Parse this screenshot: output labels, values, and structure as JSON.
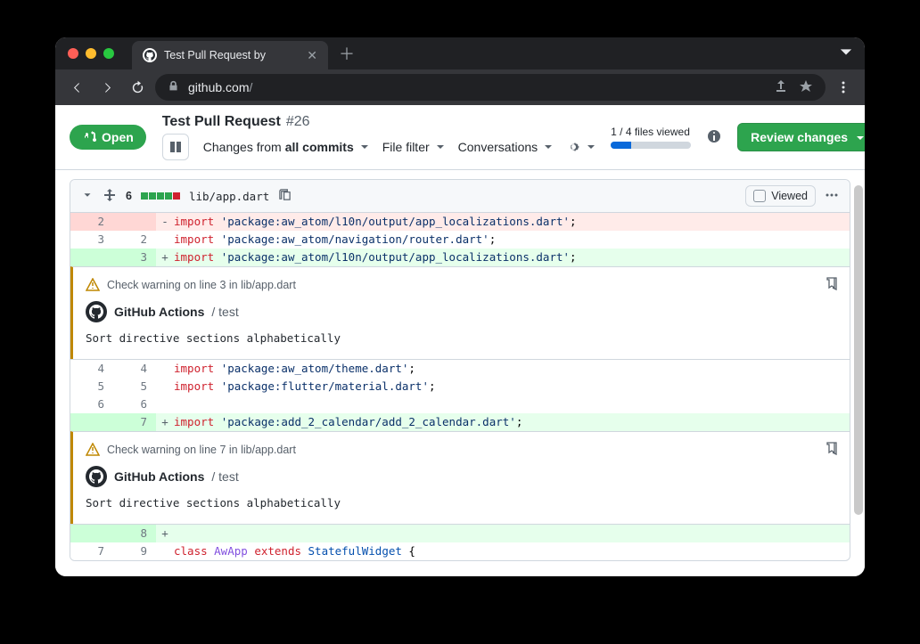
{
  "browser": {
    "tab_title": "Test Pull Request by",
    "url_host": "github.com",
    "url_path": "/"
  },
  "pr": {
    "open_label": "Open",
    "title": "Test Pull Request",
    "number": "#26",
    "changes_from_label": "Changes from",
    "changes_from_value": "all commits",
    "file_filter_label": "File filter",
    "conversations_label": "Conversations",
    "viewed_text": "1 / 4 files viewed",
    "review_label": "Review changes"
  },
  "file": {
    "change_count": "6",
    "name": "lib/app.dart",
    "viewed_label": "Viewed"
  },
  "diff": {
    "rows": [
      {
        "oldln": "2",
        "newln": "",
        "marker": "-",
        "segs": [
          {
            "t": "import ",
            "c": "kw"
          },
          {
            "t": "'package:aw_atom/l10n/output/app_localizations.dart'",
            "c": "str"
          },
          {
            "t": ";",
            "c": ""
          }
        ],
        "type": "del"
      },
      {
        "oldln": "3",
        "newln": "2",
        "marker": " ",
        "segs": [
          {
            "t": "import ",
            "c": "kw"
          },
          {
            "t": "'package:aw_atom/navigation/router.dart'",
            "c": "str"
          },
          {
            "t": ";",
            "c": ""
          }
        ],
        "type": "ctx"
      },
      {
        "oldln": "",
        "newln": "3",
        "marker": "+",
        "segs": [
          {
            "t": "import ",
            "c": "kw"
          },
          {
            "t": "'package:aw_atom/l10n/output/app_localizations.dart'",
            "c": "str"
          },
          {
            "t": ";",
            "c": ""
          }
        ],
        "type": "add"
      }
    ],
    "rows2": [
      {
        "oldln": "4",
        "newln": "4",
        "marker": " ",
        "segs": [
          {
            "t": "import ",
            "c": "kw"
          },
          {
            "t": "'package:aw_atom/theme.dart'",
            "c": "str"
          },
          {
            "t": ";",
            "c": ""
          }
        ],
        "type": "ctx"
      },
      {
        "oldln": "5",
        "newln": "5",
        "marker": " ",
        "segs": [
          {
            "t": "import ",
            "c": "kw"
          },
          {
            "t": "'package:flutter/material.dart'",
            "c": "str"
          },
          {
            "t": ";",
            "c": ""
          }
        ],
        "type": "ctx"
      },
      {
        "oldln": "6",
        "newln": "6",
        "marker": " ",
        "segs": [],
        "type": "ctx"
      },
      {
        "oldln": "",
        "newln": "7",
        "marker": "+",
        "segs": [
          {
            "t": "import ",
            "c": "kw"
          },
          {
            "t": "'package:add_2_calendar/add_2_calendar.dart'",
            "c": "str"
          },
          {
            "t": ";",
            "c": ""
          }
        ],
        "type": "add"
      }
    ],
    "rows3": [
      {
        "oldln": "",
        "newln": "8",
        "marker": "+",
        "segs": [],
        "type": "add"
      },
      {
        "oldln": "7",
        "newln": "9",
        "marker": " ",
        "segs": [
          {
            "t": "class ",
            "c": "kw"
          },
          {
            "t": "AwApp ",
            "c": "cls"
          },
          {
            "t": "extends ",
            "c": "kw"
          },
          {
            "t": "StatefulWidget ",
            "c": "typ"
          },
          {
            "t": "{",
            "c": ""
          }
        ],
        "type": "ctx"
      }
    ]
  },
  "annotations": [
    {
      "head": "Check warning on line 3 in lib/app.dart",
      "actor": "GitHub Actions",
      "sub": "/ test",
      "body": "Sort directive sections alphabetically"
    },
    {
      "head": "Check warning on line 7 in lib/app.dart",
      "actor": "GitHub Actions",
      "sub": "/ test",
      "body": "Sort directive sections alphabetically"
    }
  ]
}
